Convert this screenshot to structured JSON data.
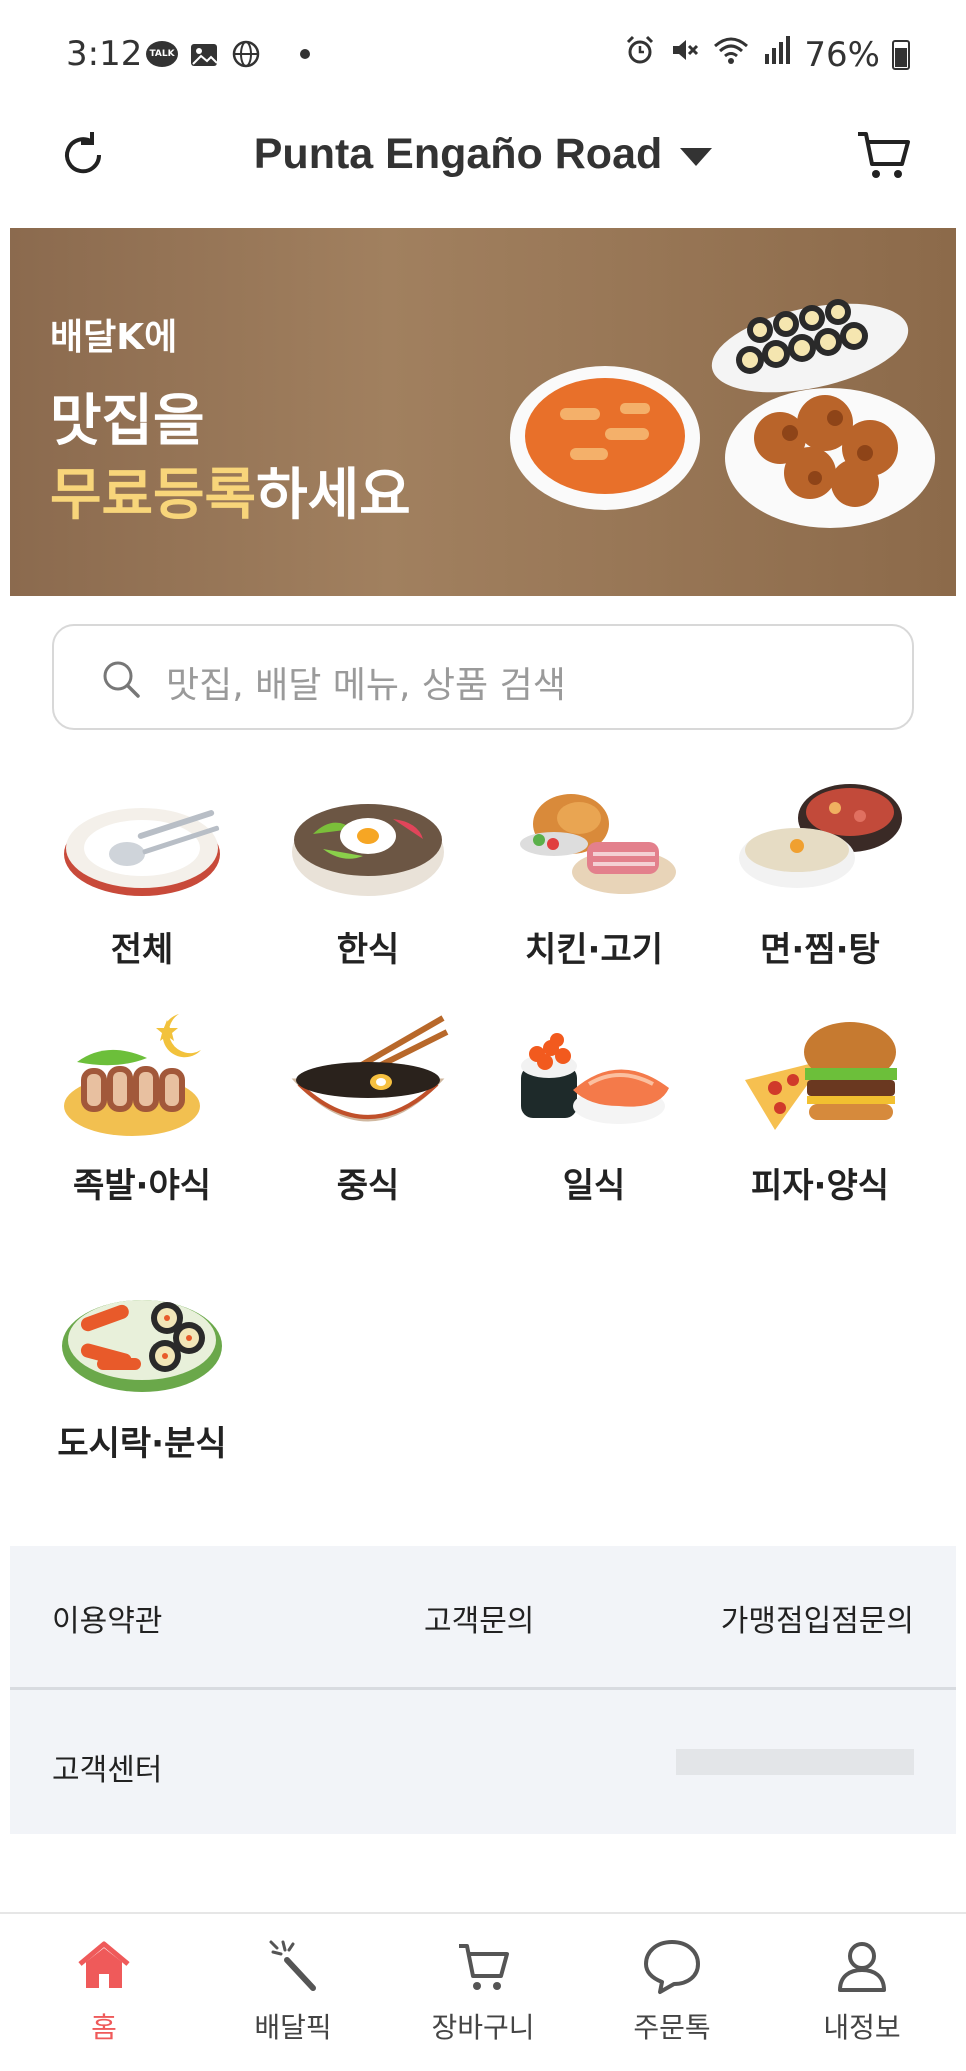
{
  "status_bar": {
    "time": "3:12",
    "battery": "76%",
    "left_icons": [
      "kakaotalk-icon",
      "gallery-icon",
      "globe-icon",
      "dot-icon"
    ],
    "right_icons": [
      "alarm-icon",
      "mute-icon",
      "wifi-icon",
      "signal-icon",
      "battery-icon"
    ]
  },
  "header": {
    "location": "Punta Engaño Road"
  },
  "banner": {
    "sub": "배달K에",
    "title_line1": "맛집을",
    "title_highlight": "무료등록",
    "title_rest": "하세요"
  },
  "search": {
    "placeholder": "맛집, 배달 메뉴, 상품 검색"
  },
  "categories": [
    {
      "label": "전체"
    },
    {
      "label": "한식"
    },
    {
      "label": "치킨·고기"
    },
    {
      "label": "면·찜·탕"
    },
    {
      "label": "족발·야식"
    },
    {
      "label": "중식"
    },
    {
      "label": "일식"
    },
    {
      "label": "피자·양식"
    },
    {
      "label": "도시락·분식"
    }
  ],
  "info": {
    "terms": "이용약관",
    "inquiry": "고객문의",
    "franchise": "가맹점입점문의",
    "customer_center": "고객센터"
  },
  "bottom_nav": [
    {
      "label": "홈",
      "icon": "home-icon"
    },
    {
      "label": "배달픽",
      "icon": "magic-wand-icon"
    },
    {
      "label": "장바구니",
      "icon": "cart-icon"
    },
    {
      "label": "주문톡",
      "icon": "chat-icon"
    },
    {
      "label": "내정보",
      "icon": "user-icon"
    }
  ],
  "colors": {
    "accent": "#ef5a5a",
    "banner_highlight": "#f8d57a",
    "banner_bg": "#9a7857",
    "panel_bg": "#f2f4f8"
  }
}
